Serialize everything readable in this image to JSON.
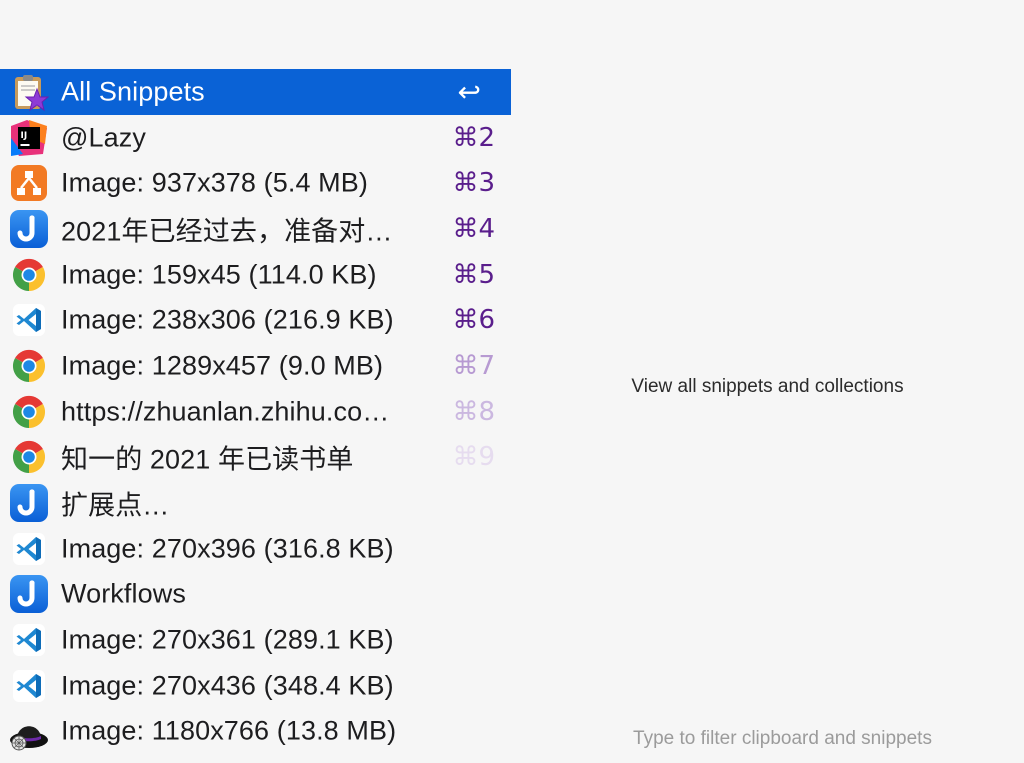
{
  "search": {
    "placeholder": ""
  },
  "items": [
    {
      "label": "All Snippets",
      "shortcut": "↩",
      "icon": "snippets-clipboard-icon",
      "shortcut_color": "#ffffff",
      "selected": true
    },
    {
      "label": "@Lazy",
      "shortcut": "⌘2",
      "icon": "intellij-idea-icon",
      "shortcut_color": "#5a1e8c"
    },
    {
      "label": "Image: 937x378 (5.4 MB)",
      "shortcut": "⌘3",
      "icon": "orange-diagram-app-icon",
      "shortcut_color": "#5a1e8c"
    },
    {
      "label": "2021年已经过去，准备对…",
      "shortcut": "⌘4",
      "icon": "joplin-icon",
      "shortcut_color": "#5a1e8c"
    },
    {
      "label": "Image: 159x45 (114.0 KB)",
      "shortcut": "⌘5",
      "icon": "chrome-icon",
      "shortcut_color": "#5a1e8c"
    },
    {
      "label": "Image: 238x306 (216.9 KB)",
      "shortcut": "⌘6",
      "icon": "vscode-icon",
      "shortcut_color": "#5a1e8c"
    },
    {
      "label": "Image: 1289x457 (9.0 MB)",
      "shortcut": "⌘7",
      "icon": "chrome-icon",
      "shortcut_color": "#b79ad2"
    },
    {
      "label": "https://zhuanlan.zhihu.co…",
      "shortcut": "⌘8",
      "icon": "chrome-icon",
      "shortcut_color": "#cbb8e0"
    },
    {
      "label": "知一的 2021 年已读书单",
      "shortcut": "⌘9",
      "icon": "chrome-icon",
      "shortcut_color": "#e6dcef"
    },
    {
      "label": "扩展点…",
      "shortcut": "",
      "icon": "joplin-icon",
      "shortcut_color": "#5a1e8c"
    },
    {
      "label": "Image: 270x396 (316.8 KB)",
      "shortcut": "",
      "icon": "vscode-icon",
      "shortcut_color": "#5a1e8c"
    },
    {
      "label": "Workflows",
      "shortcut": "",
      "icon": "joplin-icon",
      "shortcut_color": "#5a1e8c"
    },
    {
      "label": "Image: 270x361 (289.1 KB)",
      "shortcut": "",
      "icon": "vscode-icon",
      "shortcut_color": "#5a1e8c"
    },
    {
      "label": "Image: 270x436 (348.4 KB)",
      "shortcut": "",
      "icon": "vscode-icon",
      "shortcut_color": "#5a1e8c"
    },
    {
      "label": "Image: 1180x766 (13.8 MB)",
      "shortcut": "",
      "icon": "alfred-hat-icon",
      "shortcut_color": "#5a1e8c"
    }
  ],
  "detail": {
    "description": "View all snippets and collections",
    "hint": "Type to filter clipboard and snippets"
  },
  "colors": {
    "selection": "#0a62d6",
    "background": "#f6f6f6",
    "shortcut": "#5a1e8c"
  }
}
